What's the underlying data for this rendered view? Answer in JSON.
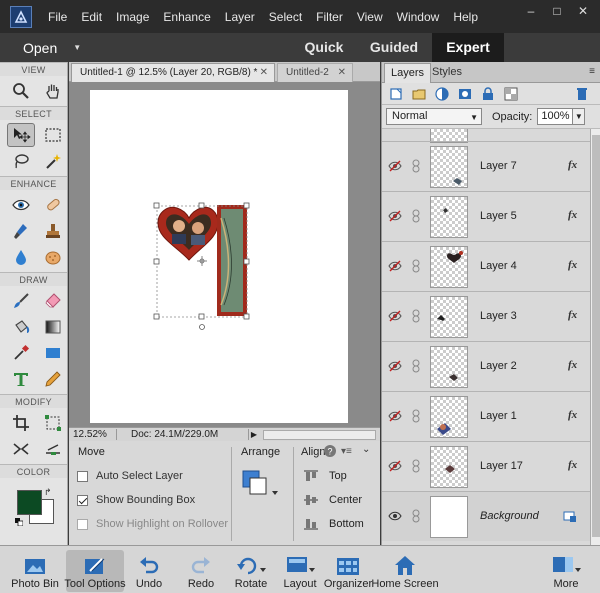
{
  "menubar": {
    "items": [
      "File",
      "Edit",
      "Image",
      "Enhance",
      "Layer",
      "Select",
      "Filter",
      "View",
      "Window",
      "Help"
    ],
    "window_buttons": [
      "–",
      "□",
      "✕"
    ]
  },
  "modebar": {
    "open_label": "Open",
    "modes": [
      "Quick",
      "Guided",
      "Expert"
    ],
    "active_mode": "Expert"
  },
  "toolbox": {
    "sections": {
      "view": "VIEW",
      "select": "SELECT",
      "enhance": "ENHANCE",
      "draw": "DRAW",
      "modify": "MODIFY",
      "color": "COLOR"
    },
    "tools": {
      "view": [
        "zoom-icon",
        "hand-icon"
      ],
      "select": [
        "move-icon",
        "marquee-icon",
        "lasso-icon",
        "magic-wand-icon"
      ],
      "enhance": [
        "red-eye-icon",
        "spot-healing-icon",
        "smart-brush-icon",
        "clone-stamp-icon",
        "blur-icon",
        "sponge-icon"
      ],
      "draw": [
        "brush-icon",
        "eraser-icon",
        "paint-bucket-icon",
        "gradient-icon",
        "eyedropper-icon",
        "shape-icon",
        "type-icon",
        "pencil-icon"
      ],
      "modify": [
        "crop-icon",
        "recompose-icon",
        "content-aware-move-icon",
        "straighten-icon"
      ]
    },
    "active_tool": "move-icon",
    "foreground_color": "#0c4a23",
    "background_color": "#ffffff"
  },
  "documents": {
    "tabs": [
      "Untitled-1 @ 12.5% (Layer 20, RGB/8) *",
      "Untitled-2"
    ],
    "active_tab": "Untitled-1 @ 12.5% (Layer 20, RGB/8) *"
  },
  "status": {
    "zoom": "12.52%",
    "doc_size": "Doc: 24.1M/229.0M"
  },
  "tool_options": {
    "tool_name": "Move",
    "auto_select_layer": {
      "label": "Auto Select Layer",
      "checked": false
    },
    "show_bounding_box": {
      "label": "Show Bounding Box",
      "checked": true
    },
    "show_highlight": {
      "label": "Show Highlight on Rollover",
      "checked": false
    },
    "arrange_label": "Arrange",
    "align_label": "Align",
    "align_options": [
      "Top",
      "Center",
      "Bottom"
    ]
  },
  "layers_panel": {
    "tabs": [
      "Layers",
      "Styles"
    ],
    "active_tab": "Layers",
    "toolbar_icons": [
      "new-layer-icon",
      "new-group-icon",
      "adjustment-layer-icon",
      "layer-mask-icon",
      "lock-all-icon",
      "lock-transparency-icon",
      "trash-icon"
    ],
    "blend_mode": "Normal",
    "opacity_label": "Opacity:",
    "opacity_value": "100%",
    "layers": [
      {
        "name": "Layer 7",
        "visible": false,
        "fx": true
      },
      {
        "name": "Layer 5",
        "visible": false,
        "fx": true
      },
      {
        "name": "Layer 4",
        "visible": false,
        "fx": true
      },
      {
        "name": "Layer 3",
        "visible": false,
        "fx": true
      },
      {
        "name": "Layer 2",
        "visible": false,
        "fx": true
      },
      {
        "name": "Layer 1",
        "visible": false,
        "fx": true
      },
      {
        "name": "Layer 17",
        "visible": false,
        "fx": true
      },
      {
        "name": "Background",
        "visible": true,
        "fx": false,
        "locked": true
      }
    ],
    "fx_label": "fx"
  },
  "bottom_bar": {
    "left": [
      "Photo Bin",
      "Tool Options",
      "Undo",
      "Redo",
      "Rotate",
      "Layout",
      "Organizer",
      "Home Screen"
    ],
    "right": "More"
  }
}
